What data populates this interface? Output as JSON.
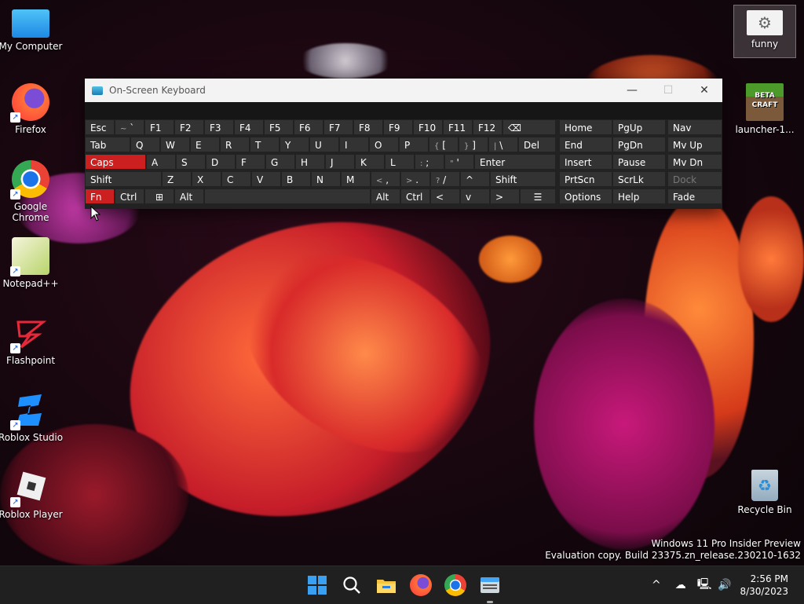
{
  "desktop": {
    "icons": [
      {
        "label": "My Computer"
      },
      {
        "label": "Firefox"
      },
      {
        "label": "Google Chrome"
      },
      {
        "label": "Notepad++"
      },
      {
        "label": "Flashpoint"
      },
      {
        "label": "Roblox Studio"
      },
      {
        "label": "Roblox Player"
      },
      {
        "label": "funny"
      },
      {
        "label": "launcher-1..."
      },
      {
        "label": "Recycle Bin"
      }
    ],
    "launcher_logo_text": "BETA CRAFT"
  },
  "osk": {
    "title": "On-Screen Keyboard",
    "controls": {
      "minimize": "—",
      "maximize": "☐",
      "close": "✕"
    },
    "row1": [
      "Esc",
      "~",
      "`",
      "F1",
      "F2",
      "F3",
      "F4",
      "F5",
      "F6",
      "F7",
      "F8",
      "F9",
      "F10",
      "F11",
      "F12",
      "⌫"
    ],
    "row2": [
      "Tab",
      "Q",
      "W",
      "E",
      "R",
      "T",
      "Y",
      "U",
      "I",
      "O",
      "P",
      "{",
      "[",
      "}",
      "]",
      "|",
      "\\",
      "Del"
    ],
    "row3": [
      "Caps",
      "A",
      "S",
      "D",
      "F",
      "G",
      "H",
      "J",
      "K",
      "L",
      ":",
      ";",
      "\"",
      "'",
      "Enter"
    ],
    "row4": [
      "Shift",
      "Z",
      "X",
      "C",
      "V",
      "B",
      "N",
      "M",
      "<",
      ",",
      ">",
      ".",
      "?",
      "/",
      "^",
      "Shift"
    ],
    "row5": [
      "Fn",
      "Ctrl",
      "⊞",
      "Alt",
      "Alt",
      "Ctrl",
      "<",
      "v",
      ">",
      "☰"
    ],
    "nav": [
      [
        "Home",
        "PgUp",
        "Nav"
      ],
      [
        "End",
        "PgDn",
        "Mv Up"
      ],
      [
        "Insert",
        "Pause",
        "Mv Dn"
      ],
      [
        "PrtScn",
        "ScrLk",
        "Dock"
      ],
      [
        "Options",
        "Help",
        "Fade"
      ]
    ]
  },
  "watermark": {
    "line1": "Windows 11 Pro Insider Preview",
    "line2": "Evaluation copy. Build 23375.zn_release.230210-1632"
  },
  "taskbar": {
    "apps": [
      "windows-start-icon",
      "search-icon",
      "file-explorer-icon",
      "firefox-icon",
      "chrome-icon",
      "on-screen-keyboard-icon"
    ],
    "tray": {
      "chevron": "^"
    },
    "time": "2:56 PM",
    "date": "8/30/2023"
  },
  "colors": {
    "accent_red": "#cc1f1f",
    "taskbar": "#202020"
  }
}
